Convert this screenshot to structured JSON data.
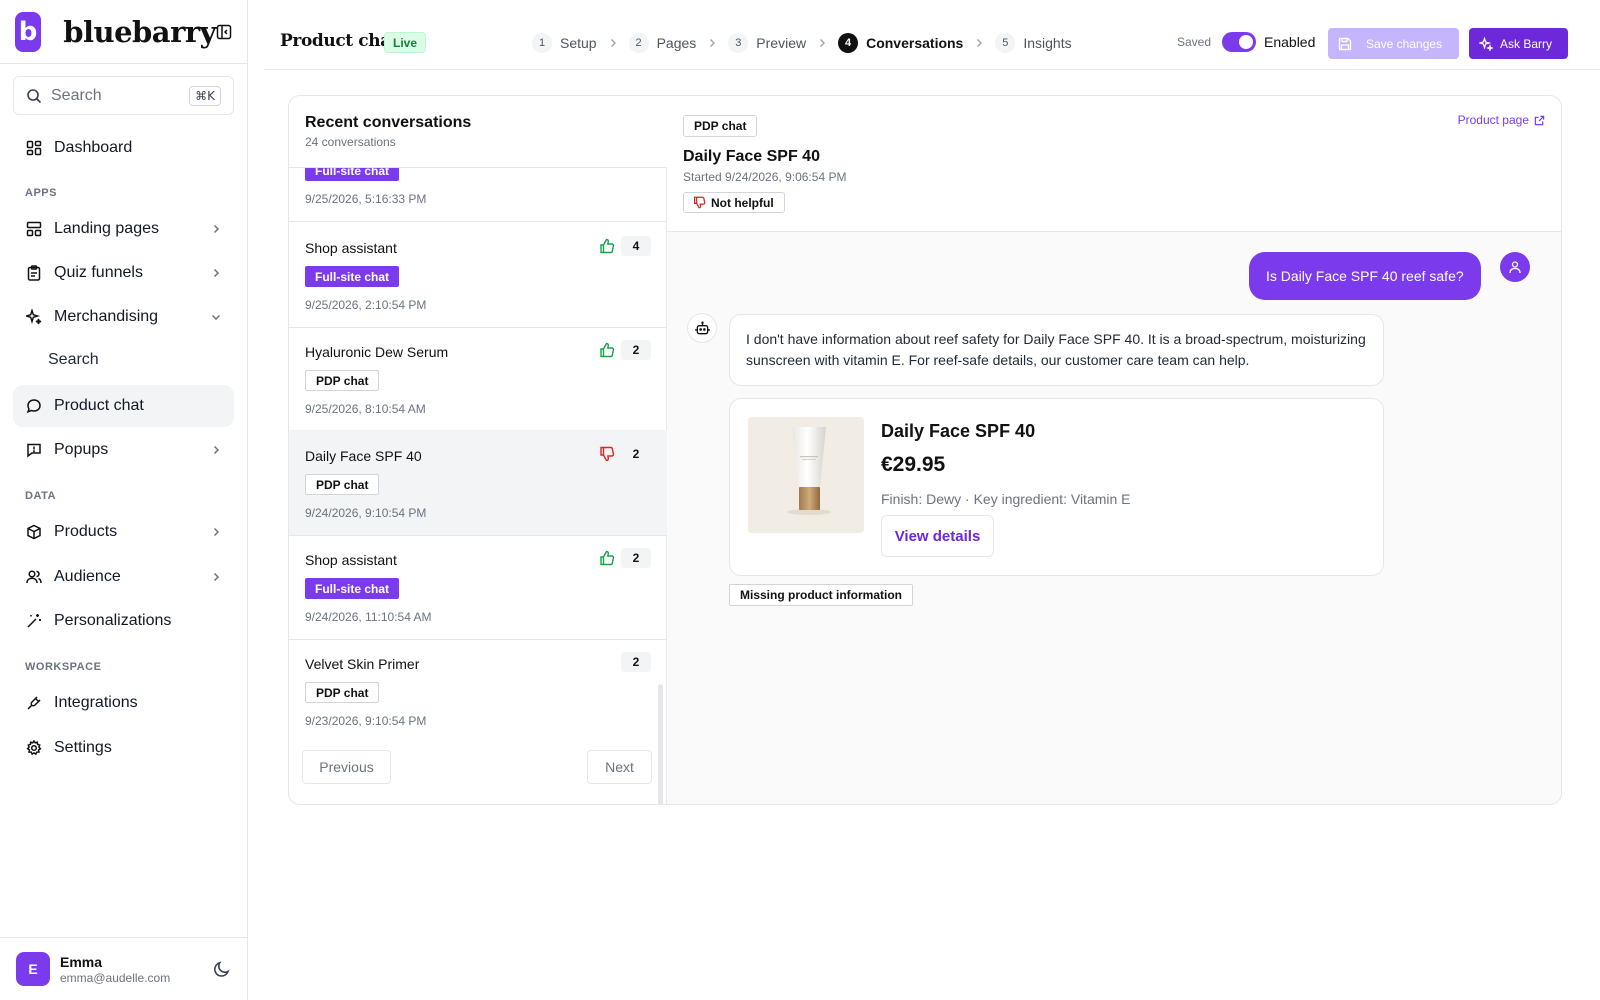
{
  "app": {
    "logo_letter": "b",
    "brand_name": "bluebarry",
    "accent_color": "#7c3aed"
  },
  "sidebar": {
    "search_placeholder": "Search",
    "search_shortcut": "⌘K",
    "dashboard": "Dashboard",
    "section_apps": "APPS",
    "landing_pages": "Landing pages",
    "quiz_funnels": "Quiz funnels",
    "merchandising": "Merchandising",
    "merchandising_search": "Search",
    "product_chat": "Product chat",
    "popups": "Popups",
    "section_data": "DATA",
    "products": "Products",
    "audience": "Audience",
    "personalizations": "Personalizations",
    "section_workspace": "WORKSPACE",
    "integrations": "Integrations",
    "settings": "Settings",
    "user": {
      "initial": "E",
      "name": "Emma",
      "email": "emma@audelle.com"
    }
  },
  "topbar": {
    "title": "Product chat",
    "status_badge": "Live",
    "steps": [
      {
        "num": "1",
        "label": "Setup"
      },
      {
        "num": "2",
        "label": "Pages"
      },
      {
        "num": "3",
        "label": "Preview"
      },
      {
        "num": "4",
        "label": "Conversations",
        "active": true
      },
      {
        "num": "5",
        "label": "Insights"
      }
    ],
    "saved_text": "Saved",
    "toggle_label": "Enabled",
    "toggle_on": true,
    "save_button": "Save changes",
    "ask_button": "Ask Barry"
  },
  "conversations": {
    "title": "Recent conversations",
    "subtitle": "24 conversations",
    "partial_item": {
      "tag": "Full-site chat",
      "date": "9/25/2026, 5:16:33 PM"
    },
    "items": [
      {
        "title": "Shop assistant",
        "tag": "Full-site chat",
        "date": "9/25/2026, 2:10:54 PM",
        "rating": "up",
        "count": "4"
      },
      {
        "title": "Hyaluronic Dew Serum",
        "tag": "PDP chat",
        "date": "9/25/2026, 8:10:54 AM",
        "rating": "up",
        "count": "2"
      },
      {
        "title": "Daily Face SPF 40",
        "tag": "PDP chat",
        "date": "9/24/2026, 9:10:54 PM",
        "rating": "down",
        "count": "2"
      },
      {
        "title": "Shop assistant",
        "tag": "Full-site chat",
        "date": "9/24/2026, 11:10:54 AM",
        "rating": "up",
        "count": "2"
      },
      {
        "title": "Velvet Skin Primer",
        "tag": "PDP chat",
        "date": "9/23/2026, 9:10:54 PM",
        "rating": "none",
        "count": "2"
      }
    ],
    "prev_button": "Previous",
    "next_button": "Next"
  },
  "detail": {
    "chip": "PDP chat",
    "title": "Daily Face SPF 40",
    "started": "Started 9/24/2026, 9:06:54 PM",
    "rating_label": "Not helpful",
    "product_page_link": "Product page",
    "user_message": "Is Daily Face SPF 40 reef safe?",
    "bot_message": "I don't have information about reef safety for Daily Face SPF 40. It is a broad-spectrum, moisturizing sunscreen with vitamin E. For reef-safe details, our customer care team can help.",
    "product": {
      "name": "Daily Face SPF 40",
      "price": "€29.95",
      "meta": "Finish: Dewy · Key ingredient: Vitamin E",
      "button": "View details"
    },
    "issue_tag": "Missing product information"
  }
}
